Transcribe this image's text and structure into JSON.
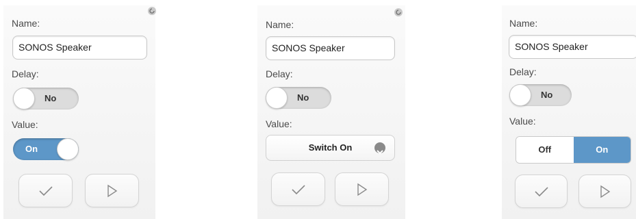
{
  "panels": [
    {
      "name_label": "Name:",
      "name_value": "SONOS Speaker",
      "delay_label": "Delay:",
      "delay_toggle": "No",
      "value_label": "Value:",
      "value_toggle": "On"
    },
    {
      "name_label": "Name:",
      "name_value": "SONOS Speaker",
      "delay_label": "Delay:",
      "delay_toggle": "No",
      "value_label": "Value:",
      "value_select": "Switch On"
    },
    {
      "name_label": "Name:",
      "name_value": "SONOS Speaker",
      "delay_label": "Delay:",
      "delay_toggle": "No",
      "value_label": "Value:",
      "value_options": [
        "Off",
        "On"
      ],
      "value_selected": "On"
    }
  ],
  "icons": {
    "confirm": "checkmark-icon",
    "play": "play-icon",
    "select_chevron": "chevron-down-icon",
    "corner": "settings-icon"
  },
  "colors": {
    "accent": "#5d97c8",
    "toggle_off": "#dcdcdc"
  }
}
